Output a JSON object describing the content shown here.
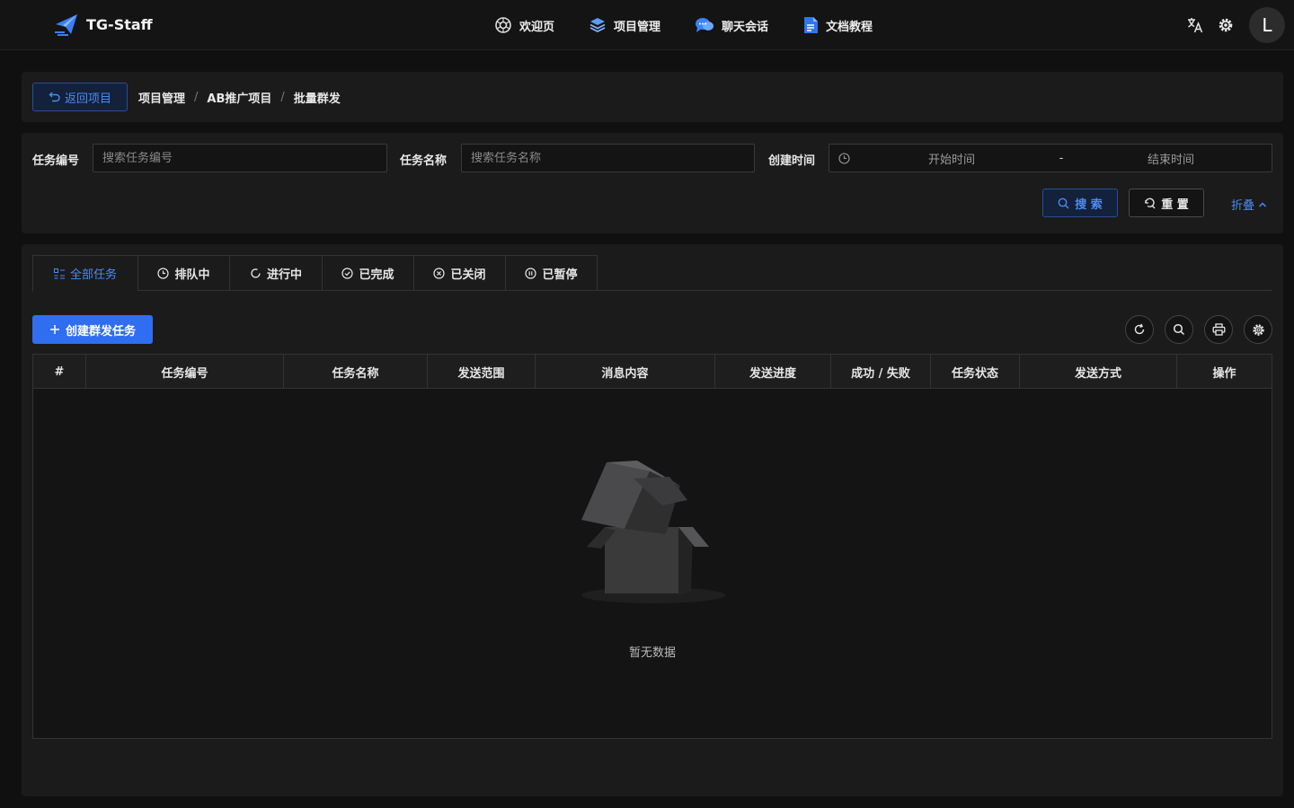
{
  "app": {
    "name": "TG-Staff"
  },
  "nav": {
    "items": [
      {
        "label": "欢迎页",
        "icon": "openai-icon"
      },
      {
        "label": "项目管理",
        "icon": "layers-icon"
      },
      {
        "label": "聊天会话",
        "icon": "chat-bubbles-icon"
      },
      {
        "label": "文档教程",
        "icon": "document-icon"
      }
    ]
  },
  "header": {
    "avatar_letter": "L"
  },
  "breadcrumb": {
    "back_label": "返回项目",
    "items": [
      "项目管理",
      "AB推广项目",
      "批量群发"
    ]
  },
  "filters": {
    "task_no_label": "任务编号",
    "task_no_placeholder": "搜索任务编号",
    "task_name_label": "任务名称",
    "task_name_placeholder": "搜索任务名称",
    "created_label": "创建时间",
    "start_placeholder": "开始时间",
    "range_sep": "-",
    "end_placeholder": "结束时间",
    "search_label": "搜 索",
    "reset_label": "重 置",
    "fold_label": "折叠"
  },
  "tabs": [
    {
      "label": "全部任务",
      "active": true
    },
    {
      "label": "排队中"
    },
    {
      "label": "进行中"
    },
    {
      "label": "已完成"
    },
    {
      "label": "已关闭"
    },
    {
      "label": "已暂停"
    }
  ],
  "toolbar": {
    "create_label": "创建群发任务"
  },
  "table": {
    "columns": [
      "#",
      "任务编号",
      "任务名称",
      "发送范围",
      "消息内容",
      "发送进度",
      "成功 / 失败",
      "任务状态",
      "发送方式",
      "操作"
    ],
    "rows": [],
    "empty_text": "暂无数据"
  },
  "colors": {
    "accent": "#2f6ef0",
    "link": "#4d8af0",
    "background": "#101010",
    "panel": "#1b1b1b"
  }
}
